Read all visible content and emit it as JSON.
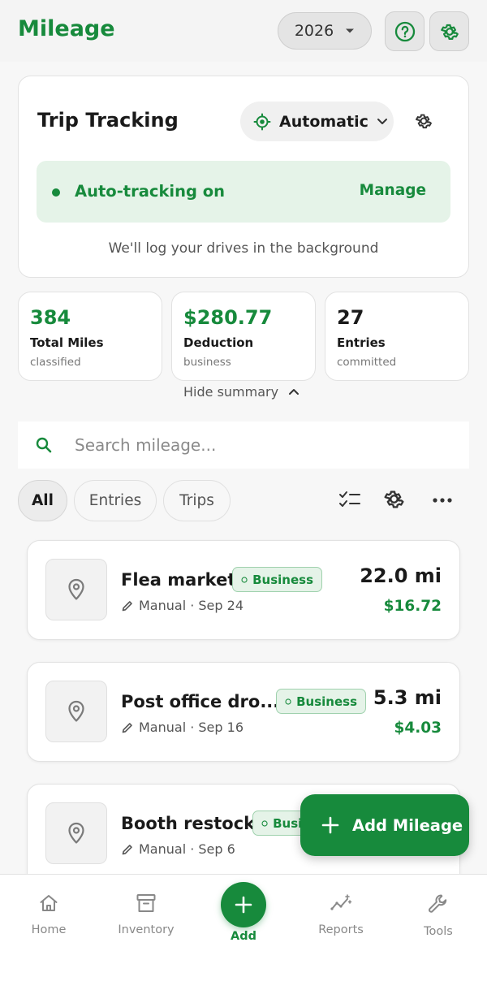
{
  "header": {
    "title": "Mileage",
    "year": "2026",
    "help_icon": "help-circle-icon",
    "settings_icon": "gear-icon"
  },
  "trip_tracking": {
    "title": "Trip Tracking",
    "mode": "Automatic",
    "status": "Auto-tracking on",
    "manage_label": "Manage",
    "note": "We'll log your drives in the background"
  },
  "stats": [
    {
      "value": "384",
      "label": "Total Miles",
      "sub": "classified",
      "color": "#178a3c"
    },
    {
      "value": "$280.77",
      "label": "Deduction",
      "sub": "business",
      "color": "#178a3c"
    },
    {
      "value": "27",
      "label": "Entries",
      "sub": "committed",
      "color": "#1a1a1a"
    }
  ],
  "hide_summary_label": "Hide summary",
  "search": {
    "placeholder": "Search mileage...",
    "value": ""
  },
  "filters": {
    "tabs": [
      "All",
      "Entries",
      "Trips"
    ],
    "active": "All"
  },
  "entries": [
    {
      "name": "Flea market",
      "category": "Business",
      "source": "Manual",
      "date": "Sep 24",
      "meta": "Manual · Sep 24",
      "miles": "22.0 mi",
      "amount": "$16.72"
    },
    {
      "name": "Post office dro...",
      "category": "Business",
      "source": "Manual",
      "date": "Sep 16",
      "meta": "Manual · Sep 16",
      "miles": "5.3 mi",
      "amount": "$4.03"
    },
    {
      "name": "Booth restock",
      "category": "Business",
      "source": "Manual",
      "date": "Sep 6",
      "meta": "Manual · Sep 6",
      "miles": "",
      "amount": ""
    }
  ],
  "fab": {
    "label": "Add Mileage"
  },
  "nav": {
    "items": [
      {
        "label": "Home",
        "icon": "home-icon"
      },
      {
        "label": "Inventory",
        "icon": "archive-box-icon"
      },
      {
        "label": "Add",
        "icon": "plus-icon"
      },
      {
        "label": "Reports",
        "icon": "sparkline-icon"
      },
      {
        "label": "Tools",
        "icon": "wrench-icon"
      }
    ]
  },
  "colors": {
    "brand_green": "#178a3c",
    "banner_bg": "#e5f3e8",
    "badge_border": "#9fd1ad"
  }
}
